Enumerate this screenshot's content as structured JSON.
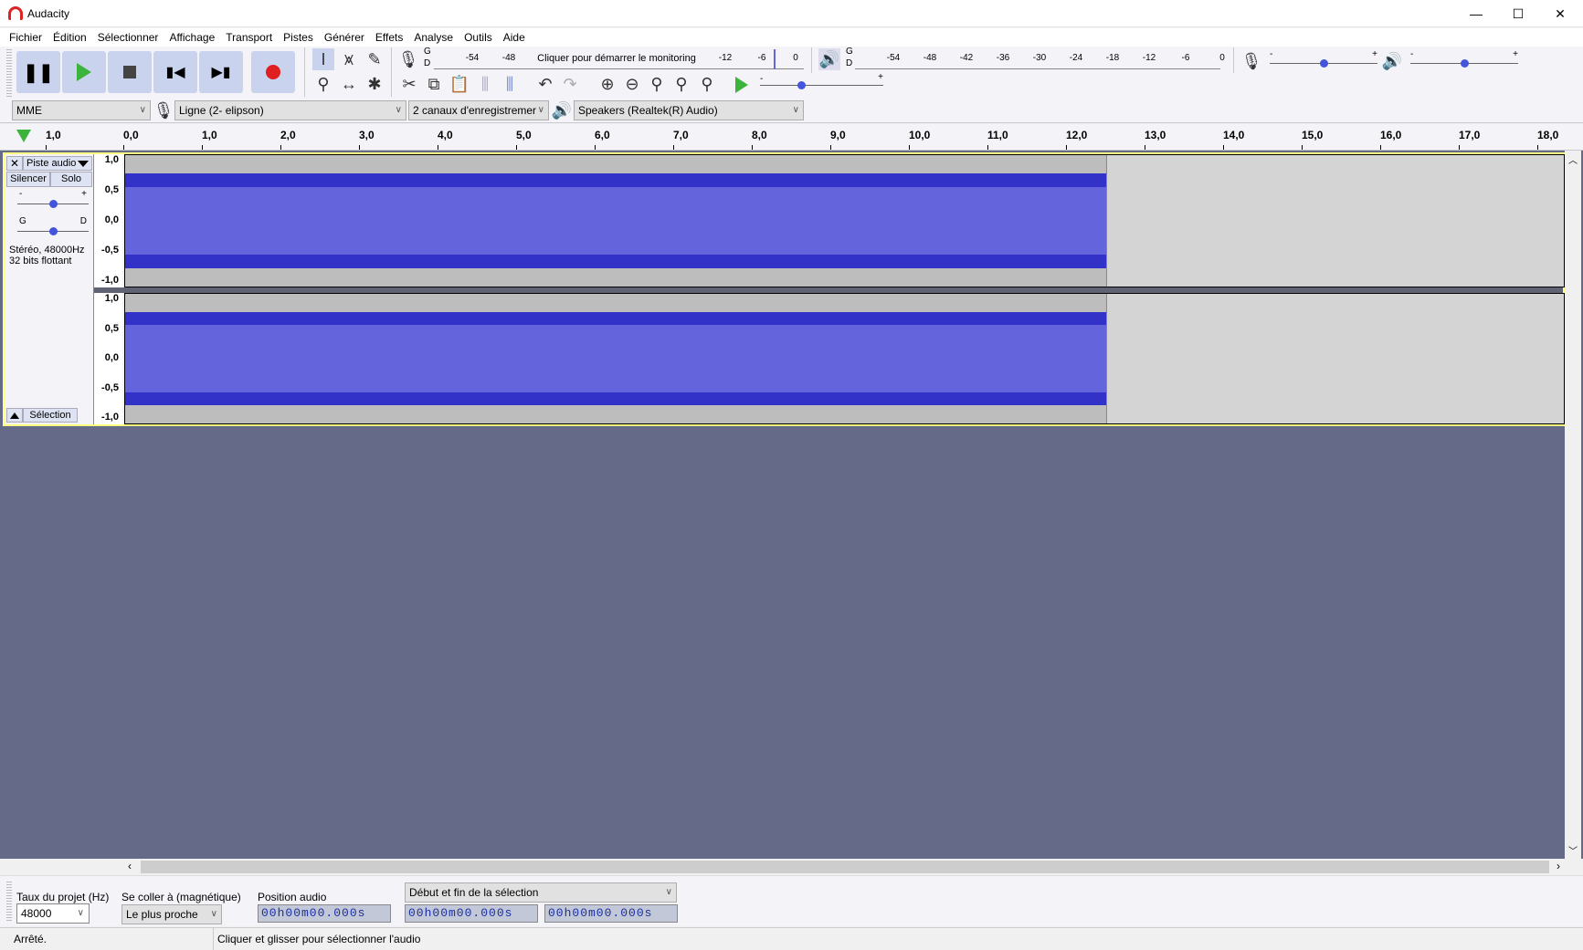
{
  "window": {
    "title": "Audacity",
    "minimize": "—",
    "maximize": "☐",
    "close": "✕"
  },
  "menu": [
    "Fichier",
    "Édition",
    "Sélectionner",
    "Affichage",
    "Transport",
    "Pistes",
    "Générer",
    "Effets",
    "Analyse",
    "Outils",
    "Aide"
  ],
  "record_meter": {
    "ticks": [
      "-54",
      "-48",
      "-12",
      "-6",
      "0"
    ],
    "hint": "Cliquer pour démarrer le monitoring",
    "channels": [
      "G",
      "D"
    ]
  },
  "play_meter": {
    "ticks": [
      "-54",
      "-48",
      "-42",
      "-36",
      "-30",
      "-24",
      "-18",
      "-12",
      "-6",
      "0"
    ],
    "channels": [
      "G",
      "D"
    ]
  },
  "sliders": {
    "minus": "-",
    "plus": "+",
    "record_volume": 0.5,
    "play_volume": 0.5,
    "play_speed": 0.33
  },
  "devices": {
    "host": "MME",
    "input": "Ligne (2- elipson)",
    "channels": "2 canaux d'enregistremer",
    "output": "Speakers (Realtek(R) Audio)"
  },
  "ruler": {
    "labels": [
      "1,0",
      "0,0",
      "1,0",
      "2,0",
      "3,0",
      "4,0",
      "5,0",
      "6,0",
      "7,0",
      "8,0",
      "9,0",
      "10,0",
      "11,0",
      "12,0",
      "13,0",
      "14,0",
      "15,0",
      "16,0",
      "17,0",
      "18,0"
    ]
  },
  "track": {
    "close": "✕",
    "name": "Piste audio",
    "mute": "Silencer",
    "solo": "Solo",
    "gain_minus": "-",
    "gain_plus": "+",
    "pan_left": "G",
    "pan_right": "D",
    "gain": 0.5,
    "pan": 0.5,
    "info1": "Stéréo, 48000Hz",
    "info2": "32 bits flottant",
    "select": "Sélection",
    "scale": [
      "1,0",
      "0,5",
      "0,0",
      "-0,5",
      "-1,0"
    ],
    "clip_end_seconds": 12.5
  },
  "selection_toolbar": {
    "rate_label": "Taux du projet (Hz)",
    "rate": "48000",
    "snap_label": "Se coller à (magnétique)",
    "snap": "Le plus proche",
    "pos_label": "Position audio",
    "pos": "00h00m00.000s",
    "sel_mode": "Début et fin de la sélection",
    "sel_start": "00h00m00.000s",
    "sel_end": "00h00m00.000s"
  },
  "status": {
    "state": "Arrêté.",
    "hint": "Cliquer et glisser pour sélectionner l'audio"
  },
  "colors": {
    "wave": "#6464dc",
    "wave_dark": "#3232c8",
    "bg": "#646a87",
    "record": "#e02020",
    "play": "#3cb43c"
  }
}
